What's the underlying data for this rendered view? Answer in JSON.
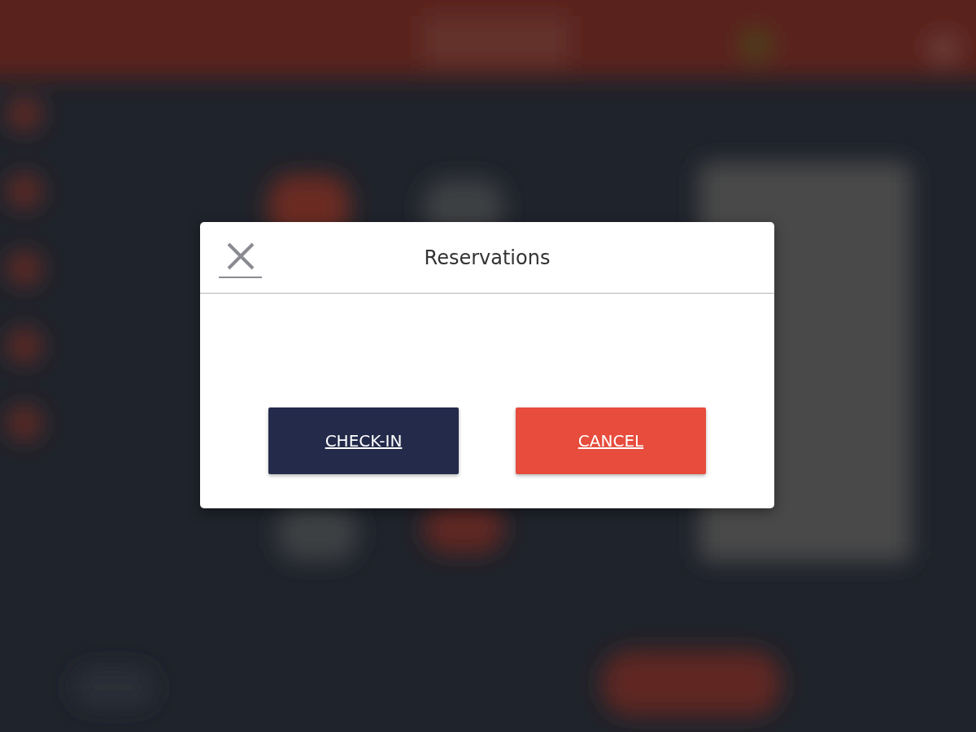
{
  "dialog": {
    "title": "Reservations",
    "buttons": [
      {
        "label": "CHECK-IN",
        "kind": "primary"
      },
      {
        "label": "CANCEL",
        "kind": "danger"
      }
    ]
  }
}
